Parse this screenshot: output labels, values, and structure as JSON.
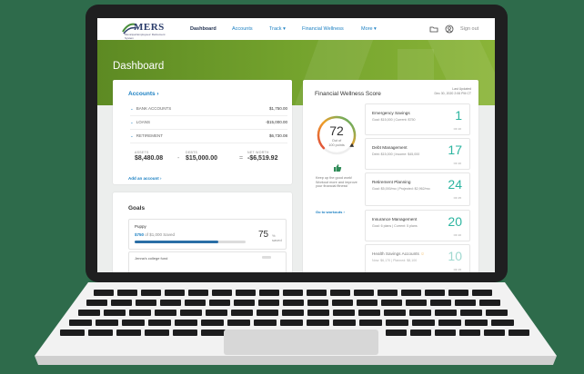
{
  "nav": {
    "logo_text": "MERS",
    "logo_sub": "Municipal Employees' Retirement System",
    "items": [
      "Dashboard",
      "Accounts",
      "Track ▾",
      "Financial Wellness",
      "More ▾"
    ],
    "signout": "Sign out"
  },
  "hero": {
    "title": "Dashboard"
  },
  "accounts": {
    "title": "Accounts ›",
    "rows": [
      {
        "label": "BANK ACCOUNTS",
        "amount": "$1,750.00"
      },
      {
        "label": "LOANS",
        "amount": "-$15,000.00"
      },
      {
        "label": "RETIREMENT",
        "amount": "$6,730.08"
      }
    ],
    "assets_label": "ASSETS",
    "assets_value": "$8,480.08",
    "debts_label": "DEBTS",
    "debts_value": "$15,000.00",
    "networth_label": "NET WORTH",
    "networth_value": "-$6,519.92",
    "minus": "-",
    "equals": "=",
    "add_link": "Add an account ›"
  },
  "goals": {
    "title": "Goals",
    "goal1": {
      "name": "Puppy",
      "saved": "$750",
      "of": "of $1,000 Saved",
      "pct": "75",
      "pct_label": "% saved",
      "progress": 0.75
    },
    "goal2": {
      "name": "Jenna's college fund"
    }
  },
  "wellness": {
    "title": "Financial Wellness Score",
    "updated_line1": "Last Updated",
    "updated_line2": "Dec 30, 2020 2:06 PM CT",
    "score": "72",
    "score_fraction": 0.72,
    "out_of": "Out of",
    "points": "100 points",
    "message": "Keep up the good work! Workout more and improve your financial fitness!",
    "link": "Go to workouts ›",
    "items": [
      {
        "name": "Emergency Savings",
        "detail": "Goal: $15,000 | Current: $750",
        "score": "1",
        "of": "OF 20"
      },
      {
        "name": "Debt Management",
        "detail": "Debt: $15,000 | Income: $45,000",
        "score": "17",
        "of": "OF 20"
      },
      {
        "name": "Retirement Planning",
        "detail": "Goal: $5,000/mo | Projected: $2,962/mo",
        "score": "24",
        "of": "OF 25"
      },
      {
        "name": "Insurance Management",
        "detail": "Goal: 6 plans | Current: 5 plans",
        "score": "20",
        "of": "OF 20"
      },
      {
        "name": "Health Savings Accounts",
        "detail": "Now: $6,170 | Planned: $8,100",
        "score": "10",
        "of": "OF 15"
      }
    ]
  },
  "colors": {
    "accent": "#1a7fc2",
    "hero": "#74a32d",
    "score": "#2cb5a0"
  }
}
